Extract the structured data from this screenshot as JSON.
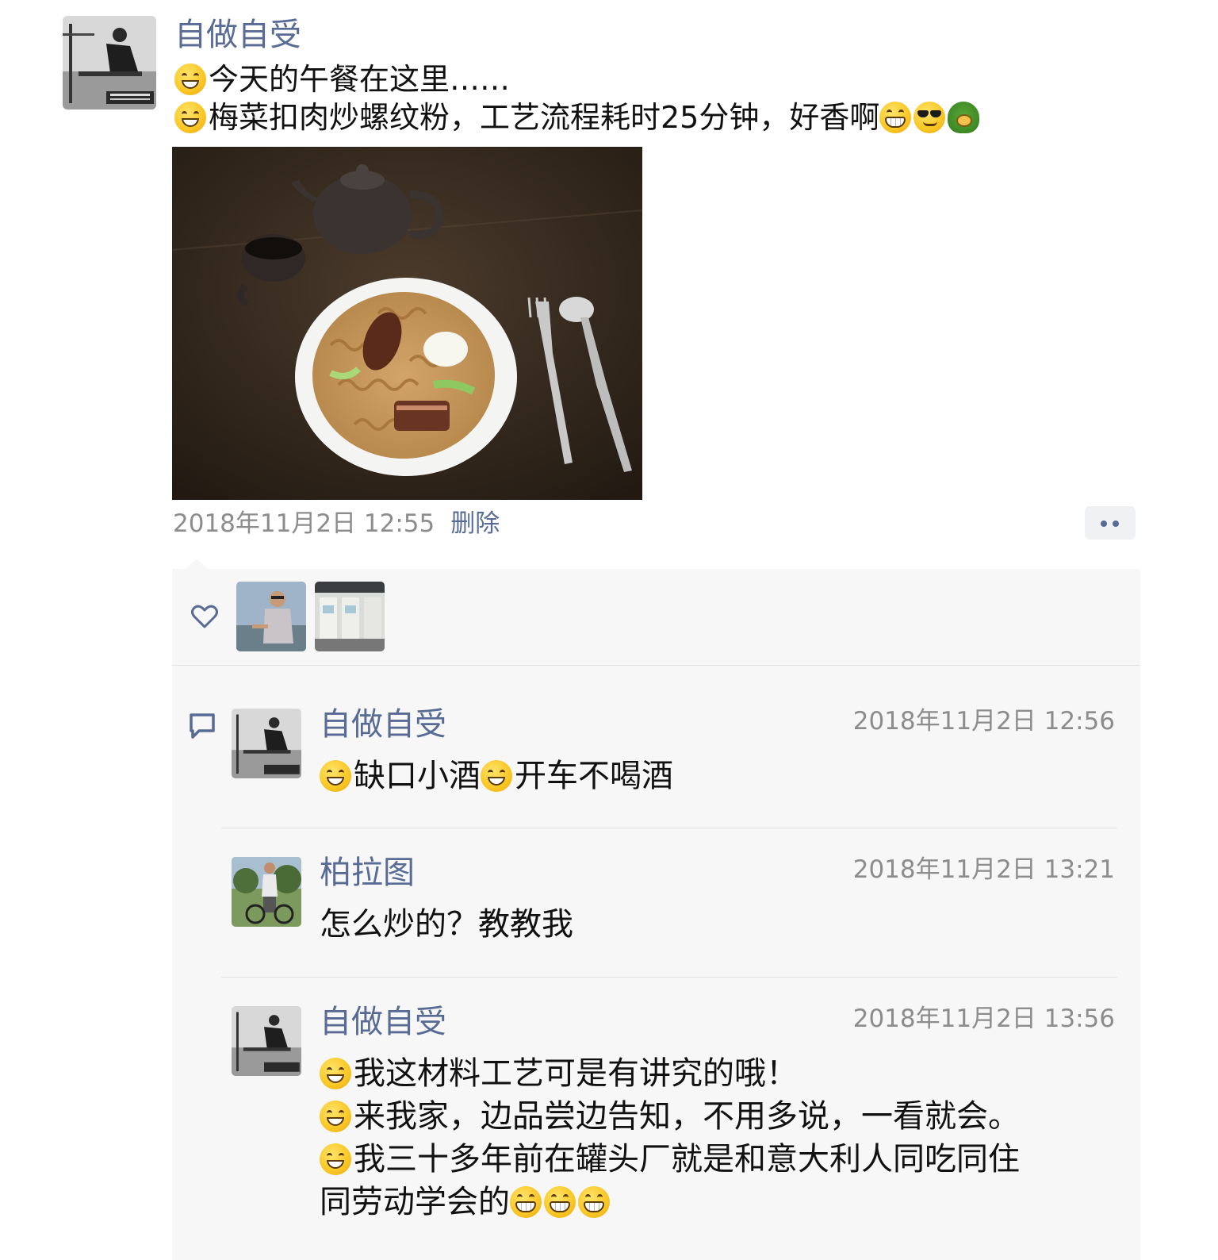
{
  "post": {
    "author": "自做自受",
    "lines": [
      "今天的午餐在这里……",
      "梅菜扣肉炒螺纹粉，工艺流程耗时25分钟，好香啊"
    ],
    "timestamp": "2018年11月2日 12:55",
    "delete_label": "删除"
  },
  "icons": {
    "more": "more-dots-icon",
    "like": "heart-icon",
    "comment": "comment-bubble-icon",
    "emoji_smile": "smile-emoji",
    "emoji_grin": "grin-emoji",
    "emoji_cool": "sunglasses-emoji",
    "emoji_turtle": "turtle-emoji"
  },
  "colors": {
    "link": "#576b95",
    "meta": "#8c8c8c",
    "panel": "#f7f7f7"
  },
  "comments": [
    {
      "name": "自做自受",
      "time": "2018年11月2日 12:56",
      "segments": [
        "缺口小酒",
        "开车不喝酒"
      ]
    },
    {
      "name": "柏拉图",
      "time": "2018年11月2日 13:21",
      "text": "怎么炒的？教教我"
    },
    {
      "name": "自做自受",
      "time": "2018年11月2日 13:56",
      "lines": [
        "我这材料工艺可是有讲究的哦！",
        "来我家，边品尝边告知，不用多说，一看就会。",
        "我三十多年前在罐头厂就是和意大利人同吃同住",
        "同劳动学会的"
      ]
    }
  ]
}
